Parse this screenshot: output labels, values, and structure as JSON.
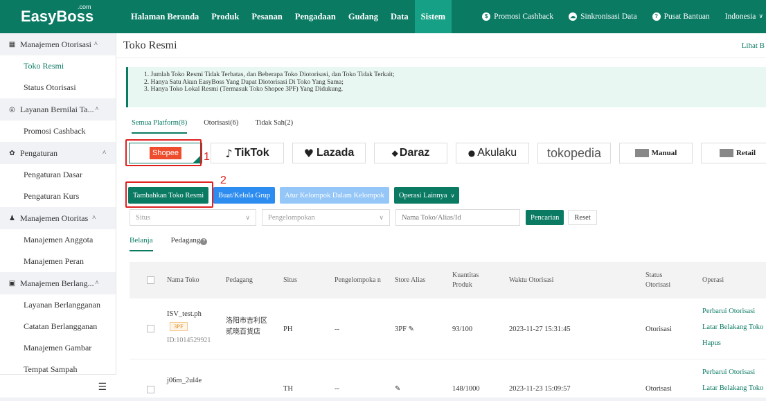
{
  "logo": {
    "text": "EasyBoss",
    "sup": ".com"
  },
  "nav": [
    {
      "label": "Halaman Beranda",
      "active": false
    },
    {
      "label": "Produk",
      "active": false
    },
    {
      "label": "Pesanan",
      "active": false
    },
    {
      "label": "Pengadaan",
      "active": false
    },
    {
      "label": "Gudang",
      "active": false
    },
    {
      "label": "Data",
      "active": false
    },
    {
      "label": "Sistem",
      "active": true
    }
  ],
  "top_right": {
    "promo": "Promosi Cashback",
    "sync": "Sinkronisasi Data",
    "help": "Pusat Bantuan",
    "language": "Indonesia"
  },
  "sidebar": [
    {
      "type": "group",
      "label": "Manajemen Otorisasi",
      "icon": "store-icon"
    },
    {
      "type": "item",
      "label": "Toko Resmi",
      "active": true
    },
    {
      "type": "item",
      "label": "Status Otorisasi"
    },
    {
      "type": "group",
      "label": "Layanan Bernilai Ta...",
      "icon": "value-service-icon"
    },
    {
      "type": "item",
      "label": "Promosi Cashback"
    },
    {
      "type": "group",
      "label": "Pengaturan",
      "icon": "gear-icon"
    },
    {
      "type": "item",
      "label": "Pengaturan Dasar"
    },
    {
      "type": "item",
      "label": "Pengaturan Kurs"
    },
    {
      "type": "group",
      "label": "Manajemen Otoritas",
      "icon": "users-icon"
    },
    {
      "type": "item",
      "label": "Manajemen Anggota"
    },
    {
      "type": "item",
      "label": "Manajemen Peran"
    },
    {
      "type": "group",
      "label": "Manajemen Berlang...",
      "icon": "subscription-icon"
    },
    {
      "type": "item",
      "label": "Layanan Berlangganan"
    },
    {
      "type": "item",
      "label": "Catatan Berlangganan"
    },
    {
      "type": "item",
      "label": "Manajemen Gambar"
    },
    {
      "type": "item",
      "label": "Tempat Sampah"
    }
  ],
  "page": {
    "title": "Toko Resmi",
    "link": "Lihat B"
  },
  "notice": [
    "1. Jumlah Toko Resmi Tidak Terbatas, dan Beberapa Toko Diotorisasi, dan Toko Tidak Terkait;",
    "2. Hanya Satu Akun EasyBoss Yang Dapat Diotorisasi Di Toko Yang Sama;",
    "3. Hanya Toko Lokal Resmi (Termasuk Toko Shopee 3PF) Yang Didukung."
  ],
  "platform_tabs": [
    "Semua Platform(8)",
    "Otorisasi(6)",
    "Tidak Sah(2)"
  ],
  "platforms": [
    "Shopee",
    "TikTok",
    "Lazada",
    "Daraz",
    "Akulaku",
    "tokopedia",
    "Manual",
    "Retail"
  ],
  "annotations": {
    "label1": "1",
    "label2": "2"
  },
  "toolbar": {
    "add": "Tambahkan Toko Resmi",
    "group": "Buat/Kelola Grup",
    "assign": "Atur Kelompok Dalam Kelompok",
    "more": "Operasi Lainnya"
  },
  "filters": {
    "site": "Situs",
    "grouping": "Pengelompokan",
    "search_placeholder": "Nama Toko/Alias/Id",
    "search": "Pencarian",
    "reset": "Reset"
  },
  "subtabs": [
    "Belanja",
    "Pedagang"
  ],
  "table": {
    "headers": {
      "name": "Nama Toko",
      "merchant": "Pedagang",
      "site": "Situs",
      "group": "Pengelompoka n",
      "alias": "Store Alias",
      "qty": "Kuantitas Produk",
      "time": "Waktu Otorisasi",
      "status": "Status Otorisasi",
      "ops": "Operasi"
    },
    "rows": [
      {
        "name": "ISV_test.ph",
        "tag": "3PF",
        "id": "ID:1014529921",
        "merchant": "洛阳市吉利区贰晓百货店",
        "site": "PH",
        "group": "--",
        "alias": "3PF",
        "qty": "93/100",
        "time": "2023-11-27 15:31:45",
        "status": "Otorisasi",
        "ops": [
          "Perbarui Otorisasi",
          "Latar Belakang Toko",
          "Hapus"
        ]
      },
      {
        "name": "j06m_2ul4e",
        "merchant": "",
        "site": "TH",
        "group": "--",
        "alias": "",
        "qty": "148/1000",
        "time": "2023-11-23 15:09:57",
        "status": "Otorisasi",
        "ops": [
          "Perbarui Otorisasi",
          "Latar Belakang Toko"
        ]
      }
    ]
  }
}
